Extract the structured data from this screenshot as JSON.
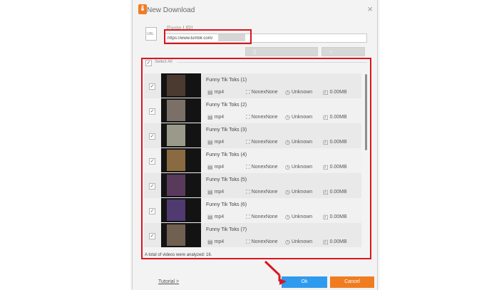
{
  "window": {
    "title": "New Download",
    "close_glyph": "×",
    "logo_glyph": "⇓"
  },
  "url": {
    "label": "Paste URL",
    "value": "https://www.tumblr.com/",
    "icon_text": "URL"
  },
  "select_all": {
    "label": "Select All",
    "checked": true,
    "check_glyph": "✓"
  },
  "rows": [
    {
      "title": "Funny Tik Toks (1)",
      "format": "mp4",
      "resolution": "NonexNone",
      "duration": "Unknown",
      "size": "0.00MB"
    },
    {
      "title": "Funny Tik Toks (2)",
      "format": "mp4",
      "resolution": "NonexNone",
      "duration": "Unknown",
      "size": "0.00MB"
    },
    {
      "title": "Funny Tik Toks (3)",
      "format": "mp4",
      "resolution": "NonexNone",
      "duration": "Unknown",
      "size": "0.00MB"
    },
    {
      "title": "Funny Tik Toks (4)",
      "format": "mp4",
      "resolution": "NonexNone",
      "duration": "Unknown",
      "size": "0.00MB"
    },
    {
      "title": "Funny Tik Toks (5)",
      "format": "mp4",
      "resolution": "NonexNone",
      "duration": "Unknown",
      "size": "0.00MB"
    },
    {
      "title": "Funny Tik Toks (6)",
      "format": "mp4",
      "resolution": "NonexNone",
      "duration": "Unknown",
      "size": "0.00MB"
    },
    {
      "title": "Funny Tik Toks (7)",
      "format": "mp4",
      "resolution": "NonexNone",
      "duration": "Unknown",
      "size": "0.00MB"
    }
  ],
  "status": {
    "total_text": "A total of videos were analyzed: 16."
  },
  "footer": {
    "tutorial_label": "Tutorial >",
    "ok_label": "Ok",
    "cancel_label": "Cancel"
  },
  "icons": {
    "format": "file-icon",
    "resolution": "resolution-icon",
    "duration": "clock-icon",
    "size": "folder-icon"
  },
  "colors": {
    "highlight": "#d9161e",
    "ok": "#2f9bef",
    "cancel": "#f07c22",
    "row_bg": "#e9e9e9",
    "row_alt_bg": "#f1f1f1"
  }
}
